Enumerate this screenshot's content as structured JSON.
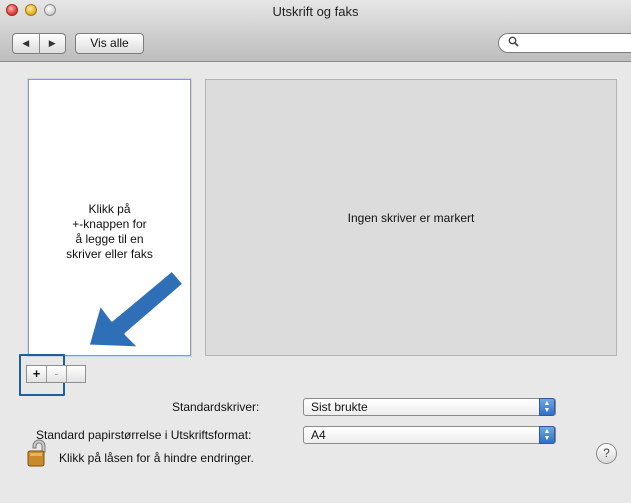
{
  "window": {
    "title": "Utskrift og faks"
  },
  "toolbar": {
    "back_icon": "◀",
    "forward_icon": "▶",
    "show_all_label": "Vis alle",
    "search_icon": "⚲",
    "search_value": ""
  },
  "printer_list": {
    "hint_lines": [
      "Klikk på",
      "+-knappen for",
      "å legge til en",
      "skriver eller faks"
    ]
  },
  "detail": {
    "empty_text": "Ingen skriver er markert"
  },
  "list_controls": {
    "add_label": "+",
    "remove_label": "-"
  },
  "settings": {
    "default_printer_label": "Standardskriver:",
    "default_printer_value": "Sist brukte",
    "paper_size_label": "Standard papirstørrelse i Utskriftsformat:",
    "paper_size_value": "A4"
  },
  "footer": {
    "lock_text": "Klikk på låsen for å hindre endringer.",
    "help_label": "?"
  },
  "colors": {
    "highlight": "#1f5f99",
    "arrow": "#2e6fb7"
  }
}
